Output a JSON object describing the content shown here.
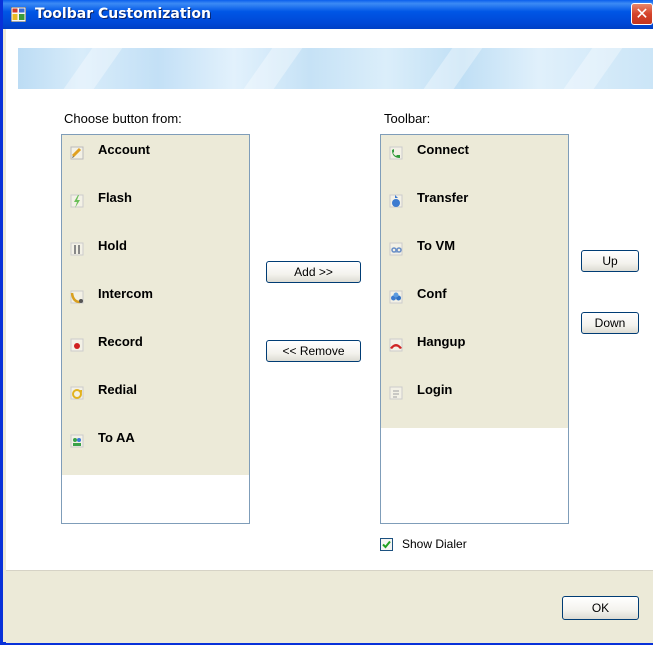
{
  "window": {
    "title": "Toolbar Customization",
    "close_glyph": "✕"
  },
  "left_panel": {
    "label": "Choose button from:",
    "items": [
      {
        "label": "Account",
        "icon": "account-icon"
      },
      {
        "label": "Flash",
        "icon": "flash-icon"
      },
      {
        "label": "Hold",
        "icon": "hold-icon"
      },
      {
        "label": "Intercom",
        "icon": "intercom-icon"
      },
      {
        "label": "Record",
        "icon": "record-icon"
      },
      {
        "label": "Redial",
        "icon": "redial-icon"
      },
      {
        "label": "To AA",
        "icon": "to-aa-icon"
      }
    ]
  },
  "right_panel": {
    "label": "Toolbar:",
    "items": [
      {
        "label": "Connect",
        "icon": "connect-icon"
      },
      {
        "label": "Transfer",
        "icon": "transfer-icon"
      },
      {
        "label": "To VM",
        "icon": "to-vm-icon"
      },
      {
        "label": "Conf",
        "icon": "conf-icon"
      },
      {
        "label": "Hangup",
        "icon": "hangup-icon"
      },
      {
        "label": "Login",
        "icon": "login-icon"
      }
    ]
  },
  "buttons": {
    "add": "Add >>",
    "remove": "<< Remove",
    "up": "Up",
    "down": "Down",
    "ok": "OK"
  },
  "show_dialer": {
    "label": "Show Dialer",
    "checked": true,
    "check_glyph": "✔"
  },
  "colors": {
    "title_bar": "#0054e3",
    "list_highlight_bg": "#ecead8",
    "list_border": "#7f9db9",
    "close_button": "#d5432a"
  }
}
